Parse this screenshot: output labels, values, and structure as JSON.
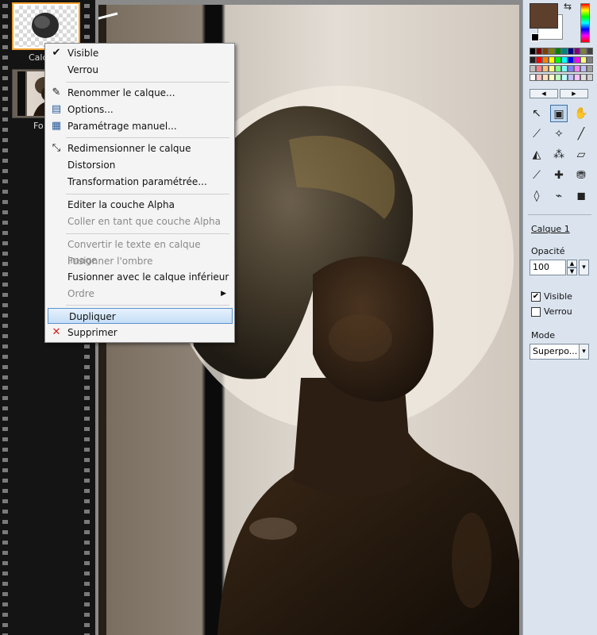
{
  "layers": {
    "items": [
      {
        "label": "Calq",
        "thumb_icon": "layer-thumb-head-silhouette"
      },
      {
        "label": "Fo",
        "thumb_icon": "layer-thumb-statue-photo"
      }
    ]
  },
  "context_menu": {
    "items": [
      {
        "label": "Visible",
        "icon": "check-icon",
        "glyph": "✔",
        "disabled": false
      },
      {
        "label": "Verrou",
        "icon": "",
        "glyph": "",
        "disabled": false
      },
      {
        "label": "Renommer le calque...",
        "icon": "rename-icon",
        "glyph": "✎",
        "disabled": false
      },
      {
        "label": "Options...",
        "icon": "options-window-icon",
        "glyph": "▤",
        "disabled": false
      },
      {
        "label": "Paramétrage manuel...",
        "icon": "manual-settings-icon",
        "glyph": "▦",
        "disabled": false
      },
      {
        "label": "Redimensionner le calque",
        "icon": "resize-icon",
        "glyph": "⤡",
        "disabled": false
      },
      {
        "label": "Distorsion",
        "icon": "",
        "glyph": "",
        "disabled": false
      },
      {
        "label": "Transformation paramétrée...",
        "icon": "",
        "glyph": "",
        "disabled": false
      },
      {
        "label": "Editer la couche Alpha",
        "icon": "",
        "glyph": "",
        "disabled": false
      },
      {
        "label": "Coller en tant que couche Alpha",
        "icon": "",
        "glyph": "",
        "disabled": true
      },
      {
        "label": "Convertir le texte en calque image",
        "icon": "",
        "glyph": "",
        "disabled": true
      },
      {
        "label": "Fusionner l'ombre",
        "icon": "",
        "glyph": "",
        "disabled": true
      },
      {
        "label": "Fusionner avec le calque inférieur",
        "icon": "",
        "glyph": "",
        "disabled": false
      },
      {
        "label": "Ordre",
        "icon": "",
        "glyph": "",
        "disabled": true,
        "submenu": true
      },
      {
        "label": "Dupliquer",
        "icon": "",
        "glyph": "",
        "disabled": false,
        "highlighted": true
      },
      {
        "label": "Supprimer",
        "icon": "delete-icon",
        "glyph": "✕",
        "disabled": false
      }
    ]
  },
  "panel": {
    "primary_color": "#5e3f2c",
    "secondary_color": "#ffffff",
    "layer_name": "Calque 1",
    "opacity_label": "Opacité",
    "opacity_value": "100",
    "visible_label": "Visible",
    "visible_checked": true,
    "lock_label": "Verrou",
    "lock_checked": false,
    "mode_label": "Mode",
    "mode_value": "Superpo..."
  },
  "palette": [
    "#000000",
    "#800000",
    "#804000",
    "#808000",
    "#008000",
    "#008080",
    "#000080",
    "#800080",
    "#808040",
    "#404040",
    "#202020",
    "#ff0000",
    "#ff8000",
    "#ffff00",
    "#00ff00",
    "#00ffff",
    "#0000ff",
    "#ff00ff",
    "#ffff80",
    "#808080",
    "#c0c0c0",
    "#ff8080",
    "#ffc080",
    "#ffff80",
    "#80ff80",
    "#80ffff",
    "#8080ff",
    "#ff80ff",
    "#c0c0ff",
    "#a0a0a0",
    "#ffffff",
    "#ffc0c0",
    "#ffe0c0",
    "#ffffc0",
    "#c0ffc0",
    "#c0ffff",
    "#c0c0ff",
    "#ffc0ff",
    "#e0e0e0",
    "#d0d0d0"
  ],
  "tools": [
    {
      "name": "arrow-select-icon",
      "glyph": "↖"
    },
    {
      "name": "layer-select-icon",
      "glyph": "▣",
      "selected": true
    },
    {
      "name": "hand-pan-icon",
      "glyph": "✋"
    },
    {
      "name": "eyedropper-icon",
      "glyph": "⟋"
    },
    {
      "name": "magic-wand-icon",
      "glyph": "✧"
    },
    {
      "name": "line-tool-icon",
      "glyph": "╱"
    },
    {
      "name": "fill-bucket-icon",
      "glyph": "◭"
    },
    {
      "name": "spray-icon",
      "glyph": "⁂"
    },
    {
      "name": "eraser-icon",
      "glyph": "▱"
    },
    {
      "name": "brush-icon",
      "glyph": "⟋"
    },
    {
      "name": "brush-plus-icon",
      "glyph": "✚"
    },
    {
      "name": "stamp-icon",
      "glyph": "⛃"
    },
    {
      "name": "blur-drop-icon",
      "glyph": "◊"
    },
    {
      "name": "smudge-icon",
      "glyph": "⌁"
    },
    {
      "name": "photo-tool-icon",
      "glyph": "◼"
    }
  ]
}
